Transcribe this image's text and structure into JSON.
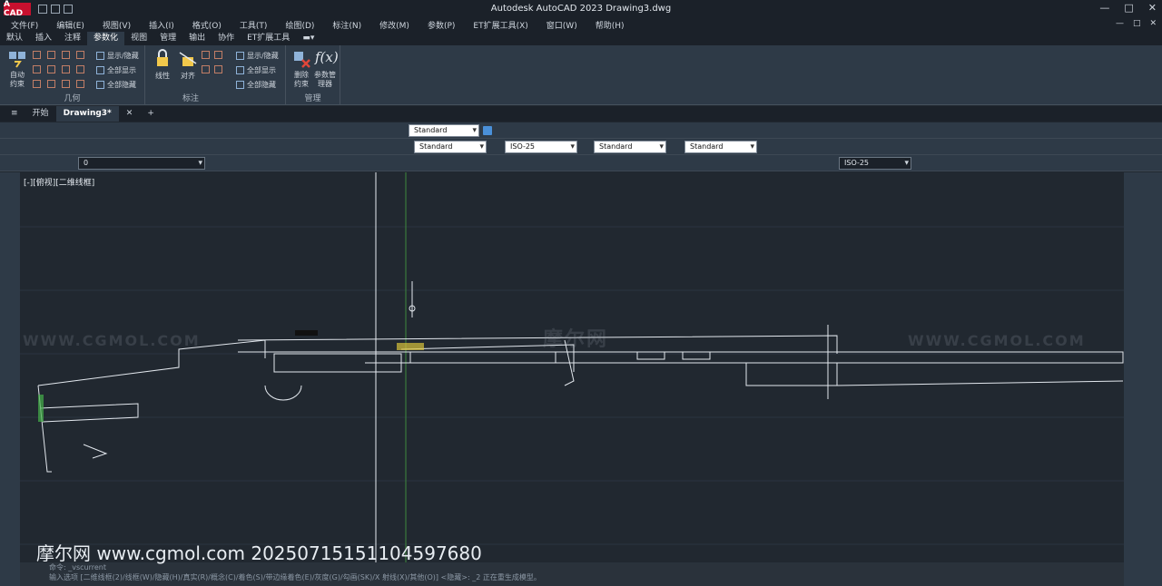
{
  "app": {
    "logo": "A CAD",
    "title": "Autodesk AutoCAD 2023    Drawing3.dwg"
  },
  "window_controls": {
    "minimize": "—",
    "restore": "□",
    "close": "✕"
  },
  "menu": [
    "文件(F)",
    "编辑(E)",
    "视图(V)",
    "插入(I)",
    "格式(O)",
    "工具(T)",
    "绘图(D)",
    "标注(N)",
    "修改(M)",
    "参数(P)",
    "ET扩展工具(X)",
    "窗口(W)",
    "帮助(H)"
  ],
  "ribbon_tabs": [
    "默认",
    "插入",
    "注释",
    "参数化",
    "视图",
    "管理",
    "输出",
    "协作",
    "ET扩展工具"
  ],
  "ribbon": {
    "geometry": {
      "auto_label": "自动约束",
      "panel_label": "几何"
    },
    "dimension": {
      "show_hide": "显示/隐藏",
      "show_all": "全部显示",
      "hide_all": "全部隐藏",
      "dim_label": "标注"
    },
    "constraint": {
      "linear": "线性",
      "aligned": "对齐"
    },
    "dim_panel_label": "标注",
    "manage": {
      "delete_label": "删除约束",
      "param_label": "参数管理器",
      "panel_label": "管理"
    },
    "geo_show_hide": "显示/隐藏",
    "geo_show_all": "全部显示",
    "geo_hide_all": "全部隐藏"
  },
  "doc_tabs": [
    {
      "label": "开始"
    },
    {
      "label": "Drawing3*"
    }
  ],
  "toolbars": {
    "textstyle_1": "Standard",
    "textstyle_2": "Standard",
    "dimstyle": "ISO-25",
    "tablestyle": "Standard",
    "mleaderstyle": "Standard",
    "layer": "0",
    "dimstyle_2": "ISO-25"
  },
  "viewport_label": "[-][俯视][二维线框]",
  "watermarks": [
    "WWW.CGMOL.COM",
    "摩尔网",
    "WWW.CGMOL.COM"
  ],
  "overlay_text": "摩尔网 www.cgmol.com 20250715151104597680",
  "command": {
    "line1": "命令:  _vscurrent",
    "line2": "输入选项 [二维线框(2)/线框(W)/隐藏(H)/真实(R)/概念(C)/着色(S)/带边缘着色(E)/灰度(G)/勾画(SK)/X 射线(X)/其他(O)] <隐藏>: _2 正在重生成模型。"
  },
  "colors": {
    "bg": "#212830",
    "panel": "#2e3a47",
    "accent": "#c8102e"
  }
}
